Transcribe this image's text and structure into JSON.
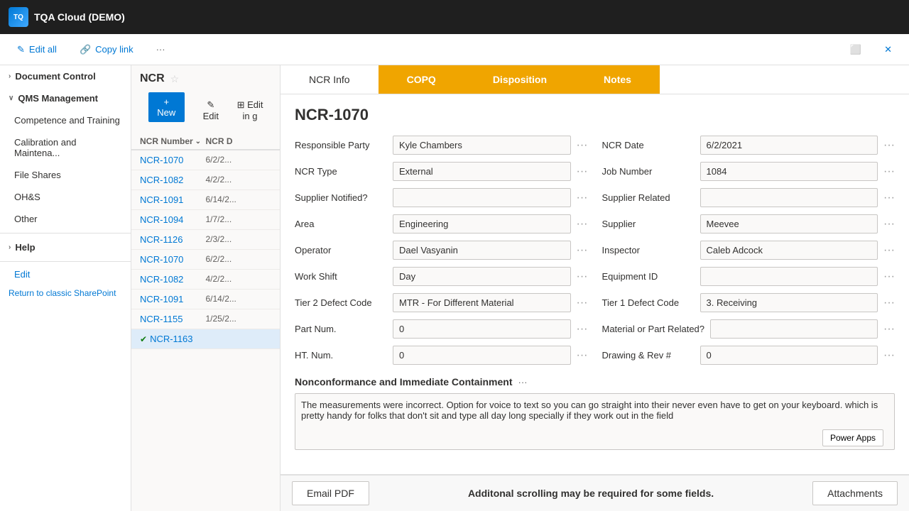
{
  "app": {
    "title": "TQA Cloud (DEMO)"
  },
  "action_bar": {
    "edit_all": "Edit all",
    "copy_link": "Copy link",
    "more": "···",
    "close": "✕"
  },
  "sidebar": {
    "items": [
      {
        "label": "Document Control",
        "indent": 1
      },
      {
        "label": "QMS Management",
        "indent": 1
      },
      {
        "label": "Competence and Training",
        "indent": 2
      },
      {
        "label": "Calibration and Maintena...",
        "indent": 2
      },
      {
        "label": "File Shares",
        "indent": 2
      },
      {
        "label": "OH&S",
        "indent": 2
      },
      {
        "label": "Other",
        "indent": 2
      },
      {
        "label": "Help",
        "indent": 1
      }
    ],
    "edit_label": "Edit",
    "return_label": "Return to classic SharePoint"
  },
  "list": {
    "title": "NCR",
    "new_btn": "+ New",
    "edit_btn": "✎ Edit",
    "editin_btn": "⊞ Edit in g",
    "col_ncr_number": "NCR Number",
    "col_ncr_date": "NCR D",
    "rows": [
      {
        "num": "NCR-1070",
        "date": "6/2/2...",
        "selected": false,
        "checked": false
      },
      {
        "num": "NCR-1082",
        "date": "4/2/2...",
        "selected": false,
        "checked": false
      },
      {
        "num": "NCR-1091",
        "date": "6/14/2...",
        "selected": false,
        "checked": false
      },
      {
        "num": "NCR-1094",
        "date": "1/7/2...",
        "selected": false,
        "checked": false
      },
      {
        "num": "NCR-1126",
        "date": "2/3/2...",
        "selected": false,
        "checked": false
      },
      {
        "num": "NCR-1070",
        "date": "6/2/2...",
        "selected": false,
        "checked": false
      },
      {
        "num": "NCR-1082",
        "date": "4/2/2...",
        "selected": false,
        "checked": false
      },
      {
        "num": "NCR-1091",
        "date": "6/14/2...",
        "selected": false,
        "checked": false
      },
      {
        "num": "NCR-1155",
        "date": "1/25/2...",
        "selected": false,
        "checked": false
      },
      {
        "num": "NCR-1163",
        "date": "",
        "selected": true,
        "checked": true
      }
    ]
  },
  "detail": {
    "title": "NCR-1070",
    "tabs": [
      "NCR Info",
      "COPQ",
      "Disposition",
      "Notes"
    ],
    "active_tab": 0,
    "fields": {
      "responsible_party_label": "Responsible Party",
      "responsible_party_value": "Kyle Chambers",
      "ncr_date_label": "NCR Date",
      "ncr_date_value": "6/2/2021",
      "ncr_type_label": "NCR Type",
      "ncr_type_value": "External",
      "job_number_label": "Job Number",
      "job_number_value": "1084",
      "supplier_notified_label": "Supplier Notified?",
      "supplier_related_label": "Supplier Related",
      "supplier_value": "Meevee",
      "supplier_label": "Supplier",
      "area_label": "Area",
      "area_value": "Engineering",
      "inspector_label": "Inspector",
      "inspector_value": "Caleb Adcock",
      "operator_label": "Operator",
      "operator_value": "Dael Vasyanin",
      "equipment_id_label": "Equipment ID",
      "equipment_id_value": "",
      "work_shift_label": "Work Shift",
      "work_shift_value": "Day",
      "tier1_defect_label": "Tier 1 Defect Code",
      "tier1_defect_value": "3. Receiving",
      "tier2_defect_label": "Tier 2 Defect Code",
      "tier2_defect_value": "MTR - For Different Material",
      "material_part_label": "Material or Part Related?",
      "part_num_label": "Part Num.",
      "part_num_value": "0",
      "drawing_rev_label": "Drawing & Rev #",
      "drawing_rev_value": "0",
      "ht_num_label": "HT. Num.",
      "ht_num_value": "0",
      "nonconformance_label": "Nonconformance and Immediate Containment",
      "nonconformance_dots": "···",
      "nonconformance_text": "The measurements were incorrect. Option for voice to text so you can go straight into their never even have to get on your keyboard. which is pretty handy for folks that don't sit and type all day long specially if they work out in the field",
      "power_apps_label": "Power Apps"
    },
    "bottom": {
      "email_pdf": "Email PDF",
      "scroll_note": "Additonal scrolling may be required for some fields.",
      "attachments": "Attachments"
    }
  }
}
